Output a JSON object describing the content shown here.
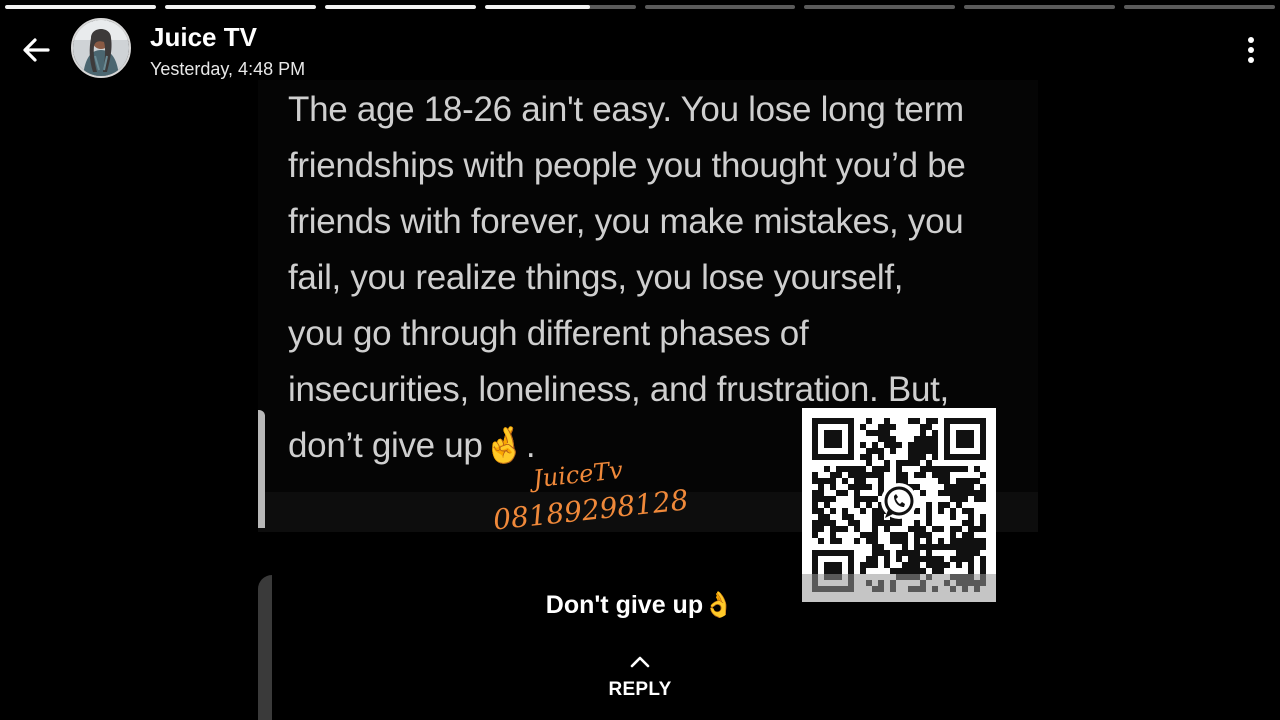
{
  "story": {
    "segments_total": 8,
    "segments_complete": 3,
    "current_segment_progress": 0.7,
    "account_name": "Juice TV",
    "timestamp": "Yesterday, 4:48 PM",
    "caption": "Don't give up👌",
    "reply_label": "REPLY"
  },
  "media": {
    "quote_text": "The age 18-26 ain't easy. You lose long term friendships with people you thought you’d be friends with forever, you make mistakes, you fail, you realize things, you lose yourself, you go through different phases of insecurities, loneliness, and frustration. But, don’t give up🤞.",
    "watermark_name": "JuiceTv",
    "watermark_phone": "08189298128",
    "watermark_color": "#f0893a"
  },
  "icons": {
    "back": "back-arrow-icon",
    "menu": "more-vertical-icon",
    "reply": "chevron-up-icon",
    "qr": "qr-code-icon",
    "whatsapp": "whatsapp-icon"
  },
  "colors": {
    "background": "#000000",
    "progress_filled": "#f2f2f2",
    "progress_empty": "#5a5a5a",
    "quote_text": "#cfcfcf"
  }
}
